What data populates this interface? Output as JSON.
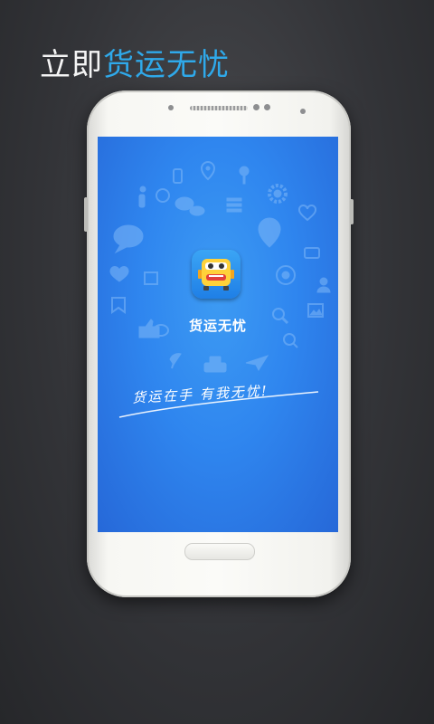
{
  "headline": {
    "white_text": "立即",
    "blue_text": "货运无忧",
    "blue_color": "#2fa9ea"
  },
  "splash": {
    "app_name": "货运无忧",
    "slogan": "货运在手 有我无忧!",
    "background_color": "#2f86ef"
  },
  "icons": [
    "phone-icon",
    "location-pin-icon",
    "pin-icon",
    "info-icon",
    "whatsapp-icon",
    "chat-bubbles-icon",
    "menu-icon",
    "gear-icon",
    "heart-icon",
    "speech-bubble-icon",
    "map-marker-icon",
    "message-icon",
    "comment-icon",
    "heart-icon",
    "image-icon",
    "bookmark-icon",
    "person-icon",
    "thumbs-up-icon",
    "image-icon",
    "chat-icon",
    "search-icon",
    "zoom-in-icon",
    "satellite-icon",
    "taxi-icon",
    "paper-plane-icon"
  ]
}
